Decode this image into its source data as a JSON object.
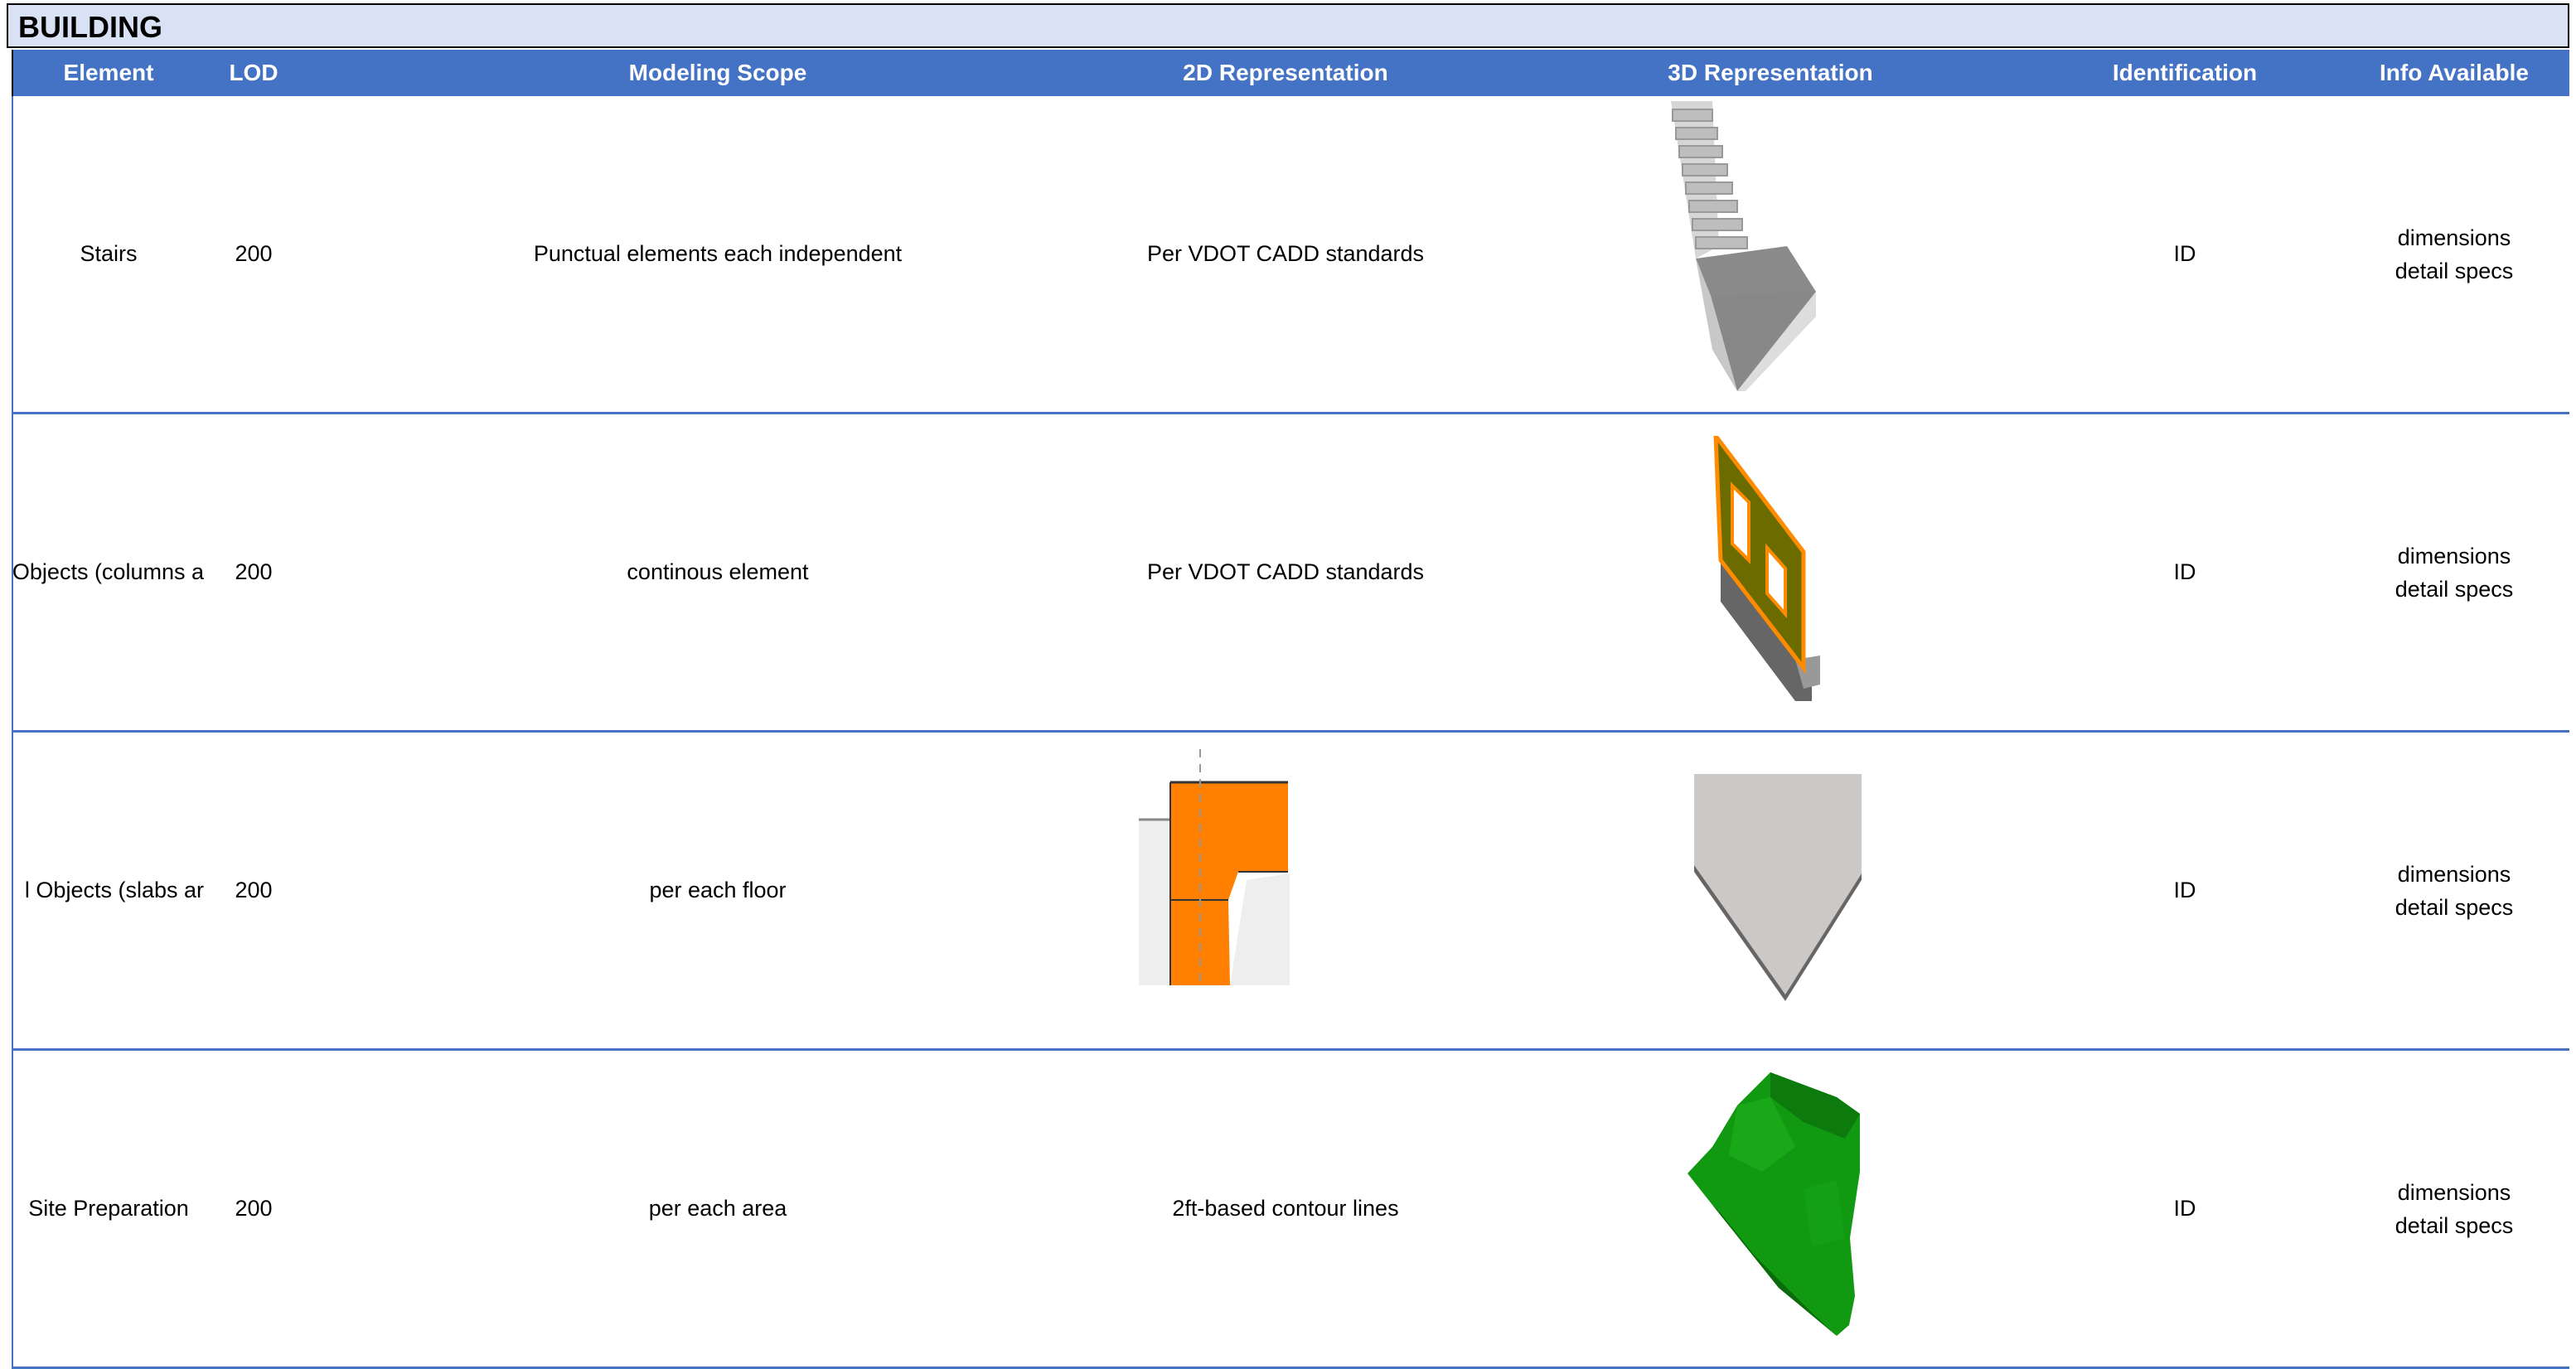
{
  "sheet": {
    "title": "BUILDING"
  },
  "header": {
    "element": "Element",
    "lod": "LOD",
    "modeling_scope": "Modeling Scope",
    "rep_2d": "2D Representation",
    "rep_3d": "3D Representation",
    "identification": "Identification",
    "info_available": "Info Available"
  },
  "rows": [
    {
      "element": "Stairs",
      "lod": "200",
      "modeling_scope": "Punctual elements each independent",
      "rep_2d": "Per VDOT CADD standards",
      "rep_3d_icon": "stairs-3d-icon",
      "identification": "ID",
      "info_line1": "dimensions",
      "info_line2": "detail specs"
    },
    {
      "element": "Objects (columns a",
      "lod": "200",
      "modeling_scope": "continous element",
      "rep_2d": "Per VDOT CADD standards",
      "rep_3d_icon": "wall-3d-icon",
      "identification": "ID",
      "info_line1": "dimensions",
      "info_line2": "detail specs"
    },
    {
      "element": "l Objects (slabs ar",
      "lod": "200",
      "modeling_scope": "per each floor",
      "rep_2d": "",
      "rep_2d_icon": "slab-section-2d-icon",
      "rep_3d_icon": "slab-3d-icon",
      "identification": "ID",
      "info_line1": "dimensions",
      "info_line2": "detail specs"
    },
    {
      "element": "Site Preparation",
      "lod": "200",
      "modeling_scope": "per each area",
      "rep_2d": "2ft-based contour lines",
      "rep_3d_icon": "terrain-3d-icon",
      "identification": "ID",
      "info_line1": "dimensions",
      "info_line2": "detail specs"
    }
  ],
  "colors": {
    "title_fill": "#d9e1f4",
    "header_fill": "#4472c4",
    "header_text": "#ffffff",
    "row_border": "#4472c4",
    "orange": "#ff7f00",
    "terrain_green": "#119911"
  }
}
